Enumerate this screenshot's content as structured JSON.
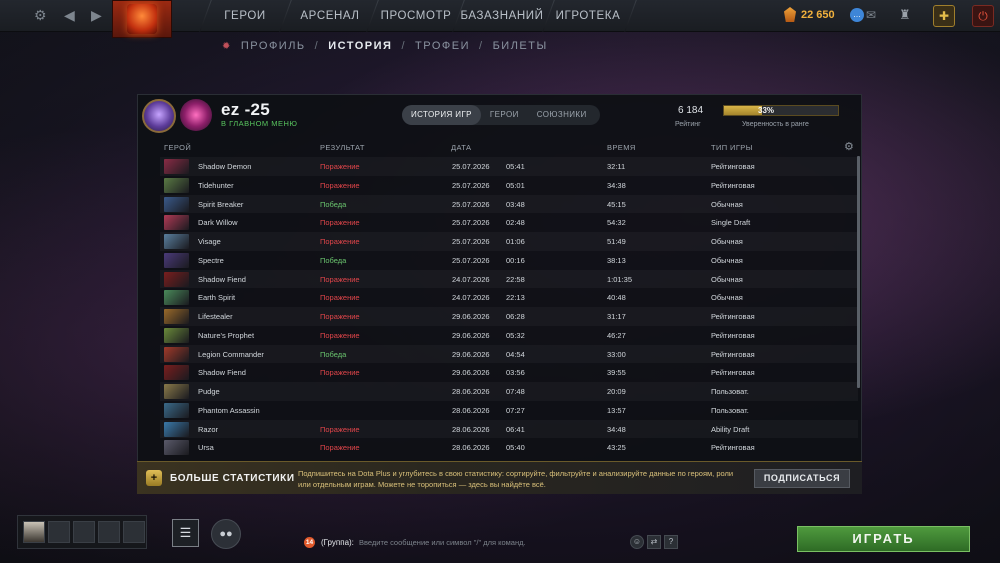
{
  "topbar": {
    "nav": [
      "ГЕРОИ",
      "АРСЕНАЛ",
      "ПРОСМОТР",
      "БАЗАЗНАНИЙ",
      "ИГРОТЕКА"
    ],
    "currency_amount": "22 650",
    "icons": [
      "gear-icon",
      "back-arrow-icon",
      "dota-logo",
      "shards-icon",
      "chat-bubble-icon",
      "mail-icon",
      "armory-icon",
      "dota-plus-icon",
      "power-icon"
    ]
  },
  "subnav": {
    "items": [
      "ПРОФИЛЬ",
      "ИСТОРИЯ",
      "ТРОФЕИ",
      "БИЛЕТЫ"
    ],
    "active": "ИСТОРИЯ"
  },
  "profile": {
    "name": "ez -25",
    "status": "В ГЛАВНОМ МЕНЮ",
    "tabs": [
      "ИСТОРИЯ ИГР",
      "ГЕРОИ",
      "СОЮЗНИКИ"
    ],
    "rating": "6 184",
    "rating_label": "Рейтинг",
    "confidence_pct": "33%",
    "confidence_value": 33,
    "confidence_label": "Уверенность в ранге"
  },
  "table": {
    "headers": [
      "ГЕРОЙ",
      "РЕЗУЛЬТАТ",
      "ДАТА",
      "ВРЕМЯ",
      "ТИП ИГРЫ"
    ],
    "rows": [
      {
        "hero": "Shadow Demon",
        "result": "Поражение",
        "date": "25.07.2026",
        "time": "05:41",
        "duration": "32:11",
        "type": "Рейтинговая",
        "color": "#8a2c45"
      },
      {
        "hero": "Tidehunter",
        "result": "Поражение",
        "date": "25.07.2026",
        "time": "05:01",
        "duration": "34:38",
        "type": "Рейтинговая",
        "color": "#5a7a44"
      },
      {
        "hero": "Spirit Breaker",
        "result": "Победа",
        "date": "25.07.2026",
        "time": "03:48",
        "duration": "45:15",
        "type": "Обычная",
        "color": "#3a5a8a"
      },
      {
        "hero": "Dark Willow",
        "result": "Поражение",
        "date": "25.07.2026",
        "time": "02:48",
        "duration": "54:32",
        "type": "Single Draft",
        "color": "#b03a55"
      },
      {
        "hero": "Visage",
        "result": "Поражение",
        "date": "25.07.2026",
        "time": "01:06",
        "duration": "51:49",
        "type": "Обычная",
        "color": "#5a7f9e"
      },
      {
        "hero": "Spectre",
        "result": "Победа",
        "date": "25.07.2026",
        "time": "00:16",
        "duration": "38:13",
        "type": "Обычная",
        "color": "#4a3a7a"
      },
      {
        "hero": "Shadow Fiend",
        "result": "Поражение",
        "date": "24.07.2026",
        "time": "22:58",
        "duration": "1:01:35",
        "type": "Обычная",
        "color": "#7a1e1e"
      },
      {
        "hero": "Earth Spirit",
        "result": "Поражение",
        "date": "24.07.2026",
        "time": "22:13",
        "duration": "40:48",
        "type": "Обычная",
        "color": "#4a8a5a"
      },
      {
        "hero": "Lifestealer",
        "result": "Поражение",
        "date": "29.06.2026",
        "time": "06:28",
        "duration": "31:17",
        "type": "Рейтинговая",
        "color": "#9a6a2a"
      },
      {
        "hero": "Nature's Prophet",
        "result": "Поражение",
        "date": "29.06.2026",
        "time": "05:32",
        "duration": "46:27",
        "type": "Рейтинговая",
        "color": "#6a8a3a"
      },
      {
        "hero": "Legion Commander",
        "result": "Победа",
        "date": "29.06.2026",
        "time": "04:54",
        "duration": "33:00",
        "type": "Рейтинговая",
        "color": "#a23a2a"
      },
      {
        "hero": "Shadow Fiend",
        "result": "Поражение",
        "date": "29.06.2026",
        "time": "03:56",
        "duration": "39:55",
        "type": "Рейтинговая",
        "color": "#7a1e1e"
      },
      {
        "hero": "Pudge",
        "result": "",
        "date": "28.06.2026",
        "time": "07:48",
        "duration": "20:09",
        "type": "Пользоват.",
        "color": "#8a7a4a"
      },
      {
        "hero": "Phantom Assassin",
        "result": "",
        "date": "28.06.2026",
        "time": "07:27",
        "duration": "13:57",
        "type": "Пользоват.",
        "color": "#3a6a8a"
      },
      {
        "hero": "Razor",
        "result": "Поражение",
        "date": "28.06.2026",
        "time": "06:41",
        "duration": "34:48",
        "type": "Ability Draft",
        "color": "#3a7aaa"
      },
      {
        "hero": "Ursa",
        "result": "Поражение",
        "date": "28.06.2026",
        "time": "05:40",
        "duration": "43:25",
        "type": "Рейтинговая",
        "color": "#5a5a6a"
      }
    ]
  },
  "banner": {
    "title": "БОЛЬШЕ СТАТИСТИКИ",
    "text": "Подпишитесь на Dota Plus и углубитесь в свою статистику: сортируйте, фильтруйте и анализируйте данные по героям, роли или отдельным играм. Можете не торопиться — здесь вы найдёте всё.",
    "button": "ПОДПИСАТЬСЯ"
  },
  "chat": {
    "count": "14",
    "channel": "(Группа):",
    "placeholder": "Введите сообщение или символ \"/\" для команд."
  },
  "play_button": "ИГРАТЬ"
}
